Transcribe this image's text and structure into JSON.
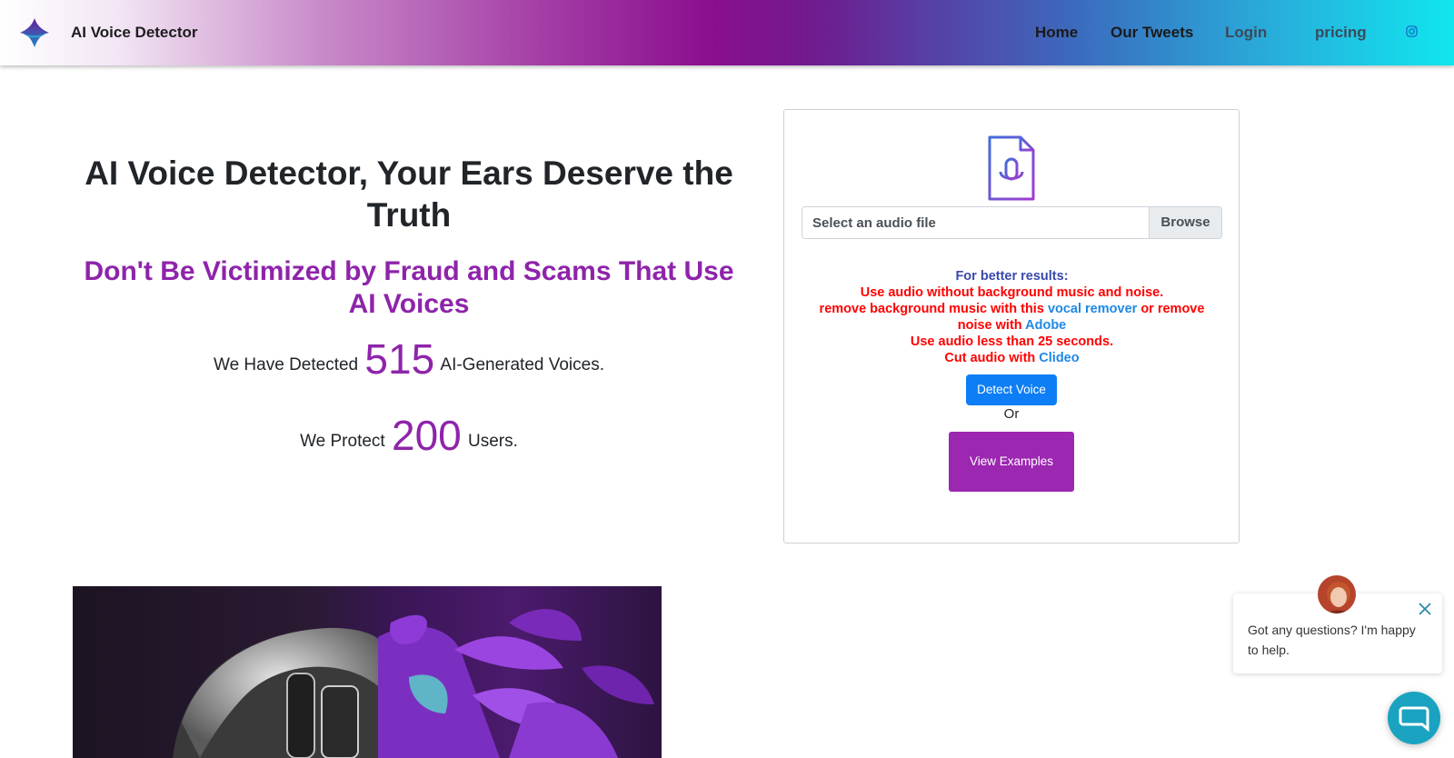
{
  "navbar": {
    "brand": "AI Voice Detector",
    "links": [
      "Home",
      "Our Tweets",
      "Login",
      "pricing"
    ]
  },
  "hero": {
    "title": "AI Voice Detector, Your Ears Deserve the Truth",
    "subtitle": "Don't Be Victimized by Fraud and Scams That Use AI Voices",
    "detected_prefix": "We Have Detected",
    "detected_count": "515",
    "detected_suffix": "AI-Generated Voices.",
    "protect_prefix": "We Protect",
    "protect_count": "200",
    "protect_suffix": "Users."
  },
  "upload": {
    "file_label": "Select an audio file",
    "browse_label": "Browse",
    "tips_header": "For better results:",
    "tip1": "Use audio without background music and noise.",
    "tip2_pre": "remove background music with this",
    "tip2_link1": "vocal remover",
    "tip2_mid": "or remove noise with",
    "tip2_link2": "Adobe",
    "tip3": "Use audio less than 25 seconds.",
    "tip4_pre": "Cut audio with",
    "tip4_link": "Clideo",
    "detect_button": "Detect Voice",
    "or_text": "Or",
    "examples_button": "View Examples"
  },
  "chat": {
    "message": "Got any questions? I'm happy to help."
  },
  "colors": {
    "accent_purple": "#8e24aa",
    "primary_blue": "#0d7ef5",
    "examples_purple": "#9c27b0",
    "warning_red": "#ff0000",
    "chat_teal": "#1aa3c0"
  }
}
